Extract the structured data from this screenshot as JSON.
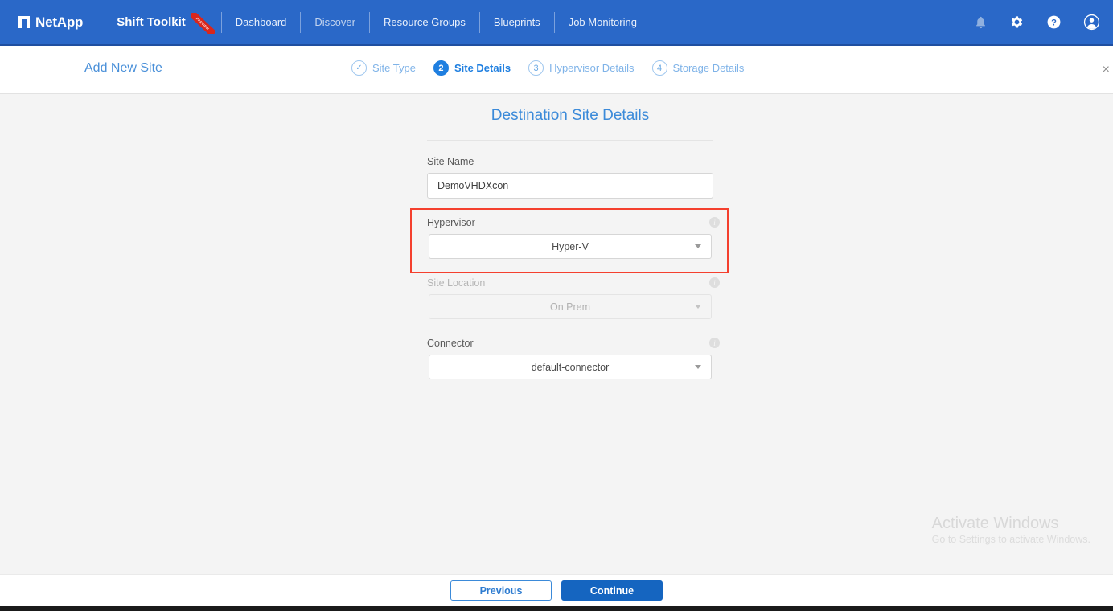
{
  "topbar": {
    "brand": "NetApp",
    "product": "Shift Toolkit",
    "ribbon_text": "PREVIEW",
    "nav": [
      {
        "label": "Dashboard",
        "active": true
      },
      {
        "label": "Discover",
        "active": false
      },
      {
        "label": "Resource Groups",
        "active": false
      },
      {
        "label": "Blueprints",
        "active": false
      },
      {
        "label": "Job Monitoring",
        "active": false
      }
    ],
    "icons": [
      {
        "name": "bell-icon",
        "glyph": "notifications"
      },
      {
        "name": "gear-icon",
        "glyph": "settings"
      },
      {
        "name": "help-icon",
        "glyph": "help"
      },
      {
        "name": "account-icon",
        "glyph": "account"
      }
    ],
    "accent_color": "#2a68c8"
  },
  "wizard": {
    "title": "Add New Site",
    "close_label": "×",
    "steps": [
      {
        "number": "✓",
        "label": "Site Type",
        "state": "done"
      },
      {
        "number": "2",
        "label": "Site Details",
        "state": "active"
      },
      {
        "number": "3",
        "label": "Hypervisor Details",
        "state": "upcoming"
      },
      {
        "number": "4",
        "label": "Storage Details",
        "state": "upcoming"
      }
    ]
  },
  "form": {
    "heading": "Destination Site Details",
    "site_name": {
      "label": "Site Name",
      "value": "DemoVHDXcon",
      "placeholder": "Site Name"
    },
    "hypervisor": {
      "label": "Hypervisor",
      "value": "Hyper-V",
      "info": "i",
      "highlighted": true,
      "highlight_color": "#f4402e"
    },
    "site_location": {
      "label": "Site Location",
      "value": "On Prem",
      "info": "i",
      "disabled": true
    },
    "connector": {
      "label": "Connector",
      "value": "default-connector",
      "info": "i"
    }
  },
  "footer": {
    "previous_label": "Previous",
    "continue_label": "Continue"
  },
  "watermark": {
    "title": "Activate Windows",
    "subtitle": "Go to Settings to activate Windows."
  }
}
